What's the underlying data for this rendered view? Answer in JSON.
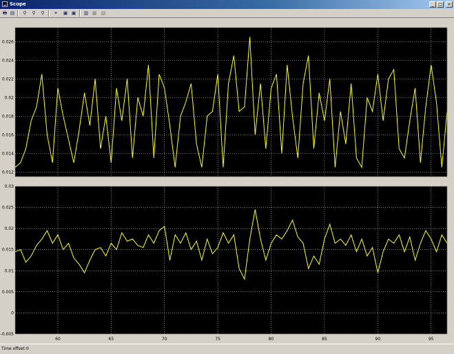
{
  "window": {
    "title": "Scope",
    "buttons": [
      "_",
      "□",
      "×"
    ]
  },
  "toolbar": {
    "icons": [
      "print-icon",
      "parameters-icon",
      "zoom-icon",
      "zoom-x-icon",
      "zoom-y-icon",
      "autoscale-icon",
      "save-axes-icon",
      "restore-axes-icon",
      "floating-scope-icon",
      "lock-axes-icon",
      "signal-selection-icon"
    ]
  },
  "status": {
    "time_offset_label": "Time offset:",
    "time_offset_value": "0"
  },
  "colors": {
    "background": "#000000",
    "trace": "#ffff00",
    "grid": "#ffffff",
    "frame": "#d4d0c8"
  },
  "chart_data": [
    {
      "type": "line",
      "xlim": [
        56,
        96.5
      ],
      "ylim": [
        0.0115,
        0.0275
      ],
      "y_ticks": [
        "0.012",
        "0.014",
        "0.016",
        "0.018",
        "0.02",
        "0.022",
        "0.024",
        "0.026"
      ],
      "y_tick_values": [
        0.012,
        0.014,
        0.016,
        0.018,
        0.02,
        0.022,
        0.024,
        0.026
      ],
      "grid": true,
      "series": [
        {
          "color": "#ffff00",
          "x": [
            56,
            56.5,
            57,
            57.5,
            58,
            58.5,
            59,
            59.5,
            60,
            60.5,
            61,
            61.5,
            62,
            62.5,
            63,
            63.5,
            64,
            64.5,
            65,
            65.5,
            66,
            66.5,
            67,
            67.5,
            68,
            68.5,
            69,
            69.5,
            70,
            70.5,
            71,
            71.5,
            72,
            72.5,
            73,
            73.5,
            74,
            74.5,
            75,
            75.5,
            76,
            76.5,
            77,
            77.5,
            78,
            78.5,
            79,
            79.5,
            80,
            80.5,
            81,
            81.5,
            82,
            82.5,
            83,
            83.5,
            84,
            84.5,
            85,
            85.5,
            86,
            86.5,
            87,
            87.5,
            88,
            88.5,
            89,
            89.5,
            90,
            90.5,
            91,
            91.5,
            92,
            92.5,
            93,
            93.5,
            94,
            94.5,
            95,
            95.5,
            96,
            96.5
          ],
          "y": [
            0.0125,
            0.013,
            0.0145,
            0.0175,
            0.019,
            0.0225,
            0.016,
            0.013,
            0.021,
            0.018,
            0.0155,
            0.013,
            0.0165,
            0.0205,
            0.017,
            0.022,
            0.0145,
            0.018,
            0.013,
            0.021,
            0.0175,
            0.022,
            0.0135,
            0.02,
            0.018,
            0.0235,
            0.0135,
            0.0225,
            0.021,
            0.017,
            0.0125,
            0.018,
            0.0195,
            0.0215,
            0.015,
            0.0125,
            0.018,
            0.0185,
            0.0225,
            0.0125,
            0.0215,
            0.0245,
            0.0185,
            0.019,
            0.0265,
            0.016,
            0.0215,
            0.0145,
            0.021,
            0.0225,
            0.014,
            0.0235,
            0.018,
            0.0135,
            0.0215,
            0.0245,
            0.0145,
            0.0205,
            0.0175,
            0.022,
            0.0125,
            0.0185,
            0.015,
            0.0215,
            0.0135,
            0.0125,
            0.02,
            0.0185,
            0.0225,
            0.0175,
            0.022,
            0.023,
            0.0145,
            0.0135,
            0.0175,
            0.021,
            0.013,
            0.019,
            0.0235,
            0.0195,
            0.0125,
            0.0185
          ]
        }
      ]
    },
    {
      "type": "line",
      "xlim": [
        56,
        96.5
      ],
      "ylim": [
        -0.005,
        0.03
      ],
      "y_ticks": [
        "-0.005",
        "0",
        "0.005",
        "0.01",
        "0.015",
        "0.02",
        "0.025",
        "0.03"
      ],
      "y_tick_values": [
        -0.005,
        0,
        0.005,
        0.01,
        0.015,
        0.02,
        0.025,
        0.03
      ],
      "x_ticks": [
        "60",
        "65",
        "70",
        "75",
        "80",
        "85",
        "90",
        "95"
      ],
      "x_tick_values": [
        60,
        65,
        70,
        75,
        80,
        85,
        90,
        95
      ],
      "grid": true,
      "series": [
        {
          "color": "#ffff00",
          "x": [
            56,
            56.5,
            57,
            57.5,
            58,
            58.5,
            59,
            59.5,
            60,
            60.5,
            61,
            61.5,
            62,
            62.5,
            63,
            63.5,
            64,
            64.5,
            65,
            65.5,
            66,
            66.5,
            67,
            67.5,
            68,
            68.5,
            69,
            69.5,
            70,
            70.5,
            71,
            71.5,
            72,
            72.5,
            73,
            73.5,
            74,
            74.5,
            75,
            75.5,
            76,
            76.5,
            77,
            77.5,
            78,
            78.5,
            79,
            79.5,
            80,
            80.5,
            81,
            81.5,
            82,
            82.5,
            83,
            83.5,
            84,
            84.5,
            85,
            85.5,
            86,
            86.5,
            87,
            87.5,
            88,
            88.5,
            89,
            89.5,
            90,
            90.5,
            91,
            91.5,
            92,
            92.5,
            93,
            93.5,
            94,
            94.5,
            95,
            95.5,
            96,
            96.5
          ],
          "y": [
            0.0145,
            0.015,
            0.012,
            0.0135,
            0.016,
            0.0175,
            0.0195,
            0.0165,
            0.0185,
            0.015,
            0.0165,
            0.013,
            0.0115,
            0.0095,
            0.0125,
            0.015,
            0.0155,
            0.0135,
            0.0165,
            0.015,
            0.019,
            0.017,
            0.0175,
            0.016,
            0.0155,
            0.0185,
            0.0165,
            0.0195,
            0.0205,
            0.0125,
            0.0185,
            0.0165,
            0.019,
            0.015,
            0.017,
            0.0125,
            0.0175,
            0.014,
            0.0155,
            0.019,
            0.0165,
            0.0185,
            0.0105,
            0.008,
            0.0175,
            0.0245,
            0.0175,
            0.0125,
            0.0165,
            0.0185,
            0.0175,
            0.0195,
            0.022,
            0.018,
            0.0165,
            0.0105,
            0.0135,
            0.0115,
            0.0175,
            0.021,
            0.0165,
            0.0175,
            0.016,
            0.0185,
            0.0145,
            0.0175,
            0.0135,
            0.0155,
            0.0095,
            0.0145,
            0.0175,
            0.0165,
            0.0185,
            0.0145,
            0.018,
            0.0125,
            0.0165,
            0.0195,
            0.0175,
            0.0145,
            0.0185,
            0.0165
          ]
        }
      ]
    }
  ]
}
